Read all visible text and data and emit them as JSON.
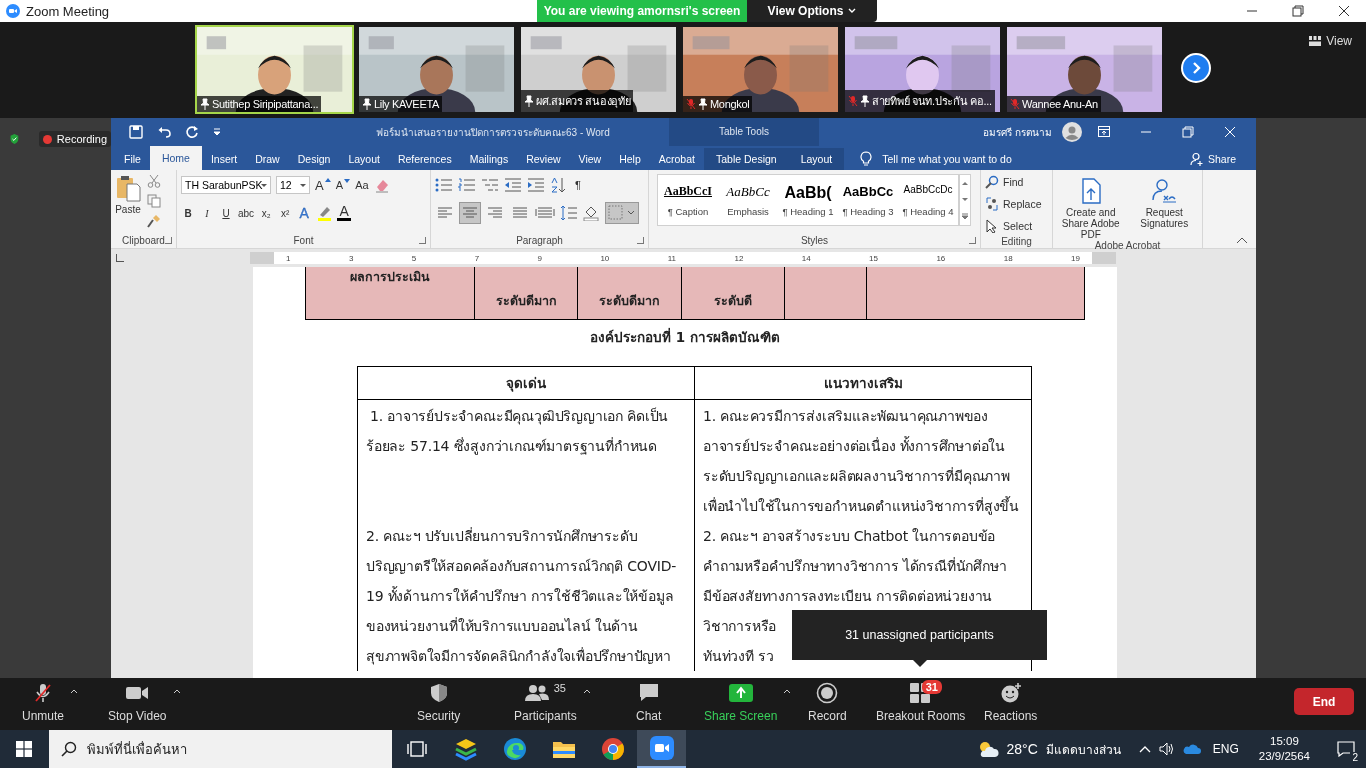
{
  "zoom": {
    "title": "Zoom Meeting",
    "banner": "You are viewing amornsri's screen",
    "view_options": "View Options"
  },
  "video_strip": {
    "view_button": "View",
    "tiles": [
      {
        "name": "Sutithep Siripipattana...",
        "pinned": true,
        "muted": false,
        "speaking": true
      },
      {
        "name": "Lily KAVEETA",
        "pinned": true,
        "muted": false,
        "speaking": false
      },
      {
        "name": "ผศ.สมควร  สนองอุทัย",
        "pinned": true,
        "muted": false,
        "speaking": false
      },
      {
        "name": "Mongkol",
        "pinned": true,
        "muted": true,
        "speaking": false
      },
      {
        "name": "สายทิพย์ จนท.ประกัน คอ...",
        "pinned": true,
        "muted": true,
        "speaking": false
      },
      {
        "name": "Wannee Anu-An",
        "pinned": false,
        "muted": true,
        "speaking": false
      }
    ]
  },
  "recording": {
    "label": "Recording"
  },
  "word": {
    "title": "ฟอร์มนำเสนอรายงานปิดการตรวจระดับคณะ63  -  Word",
    "table_tools": "Table Tools",
    "user": "อมรศรี กรตนาม",
    "tabs": [
      {
        "label": "File",
        "selected": false,
        "contextual": false
      },
      {
        "label": "Home",
        "selected": true,
        "contextual": false
      },
      {
        "label": "Insert",
        "selected": false,
        "contextual": false
      },
      {
        "label": "Draw",
        "selected": false,
        "contextual": false
      },
      {
        "label": "Design",
        "selected": false,
        "contextual": false
      },
      {
        "label": "Layout",
        "selected": false,
        "contextual": false
      },
      {
        "label": "References",
        "selected": false,
        "contextual": false
      },
      {
        "label": "Mailings",
        "selected": false,
        "contextual": false
      },
      {
        "label": "Review",
        "selected": false,
        "contextual": false
      },
      {
        "label": "View",
        "selected": false,
        "contextual": false
      },
      {
        "label": "Help",
        "selected": false,
        "contextual": false
      },
      {
        "label": "Acrobat",
        "selected": false,
        "contextual": false
      },
      {
        "label": "Table Design",
        "selected": false,
        "contextual": true
      },
      {
        "label": "Layout",
        "selected": false,
        "contextual": true
      }
    ],
    "tell_me": "Tell me what you want to do",
    "share": "Share",
    "ribbon": {
      "clipboard": {
        "paste": "Paste",
        "label": "Clipboard"
      },
      "font": {
        "name": "TH SarabunPSK",
        "size": "12",
        "grow": "A",
        "shrink": "A",
        "change_case": "Aa",
        "format_buttons": [
          "B",
          "I",
          "U",
          "abc",
          "x₂",
          "x²"
        ],
        "effects": "A",
        "color_letter": "A",
        "label": "Font"
      },
      "paragraph": {
        "pilcrow": "¶",
        "label": "Paragraph"
      },
      "styles": {
        "label": "Styles",
        "items": [
          {
            "sample": "AaBbCcI",
            "label": "¶ Caption",
            "kind": "caption"
          },
          {
            "sample": "AaBbCc",
            "label": "Emphasis",
            "kind": "emphasis"
          },
          {
            "sample": "AaBb(",
            "label": "¶ Heading 1",
            "kind": "h1"
          },
          {
            "sample": "AaBbCc",
            "label": "¶ Heading 3",
            "kind": "h3"
          },
          {
            "sample": "AaBbCcDc",
            "label": "¶ Heading 4",
            "kind": "h4"
          }
        ]
      },
      "editing": {
        "label": "Editing",
        "items": [
          {
            "label": "Find",
            "kind": "find"
          },
          {
            "label": "Replace",
            "kind": "replace"
          },
          {
            "label": "Select",
            "kind": "select"
          }
        ]
      },
      "acrobat": {
        "label": "Adobe Acrobat",
        "items": [
          {
            "label": "Create and Share Adobe PDF",
            "kind": "pdf"
          },
          {
            "label": "Request Signatures",
            "kind": "sign"
          }
        ]
      }
    },
    "ruler": {
      "numbers": [
        "1",
        "3",
        "5",
        "7",
        "9",
        "10",
        "11",
        "12",
        "14",
        "15",
        "16",
        "18",
        "19"
      ]
    }
  },
  "document": {
    "score_row": [
      "ผลการประเมิน",
      "ระดับดีมาก",
      "ระดับดีมาก",
      "ระดับดี"
    ],
    "heading": "องค์ประกอบที่ 1 การผลิตบัณฑิต",
    "table": {
      "columns": [
        "จุดเด่น",
        "แนวทางเสริม"
      ],
      "rows": [
        [
          [
            "1. อาจารย์ประจำคณะมีคุณวุฒิปริญญาเอก คิดเป็น",
            "ร้อยละ 57.14 ซึ่งสูงกว่าเกณฑ์มาตรฐานที่กำหนด"
          ],
          [
            "1. คณะควรมีการส่งเสริมและพัฒนาคุณภาพของ",
            "อาจารย์ประจำคณะอย่างต่อเนื่อง ทั้งการศึกษาต่อใน",
            "ระดับปริญญาเอกและผลิตผลงานวิชาการที่มีคุณภาพ",
            "เพื่อนำไปใช้ในการขอกำหนดตำแหน่งวิชาการที่สูงขึ้น"
          ]
        ],
        [
          [
            "2. คณะฯ ปรับเปลี่ยนการบริการนักศึกษาระดับ",
            "ปริญญาตรีให้สอดคล้องกับสถานการณ์วิกฤติ COVID-",
            "19 ทั้งด้านการให้คำปรึกษา การใช้ชีวิตและให้ข้อมูล",
            "ของหน่วยงานที่ให้บริการแบบออนไลน์ ในด้าน",
            "สุขภาพจิตใจมีการจัดคลินิกกำลังใจเพื่อปรึกษาปัญหา"
          ],
          [
            "2. คณะฯ อาจสร้างระบบ Chatbot ในการตอบข้อ",
            "คำถามหรือคำปรึกษาทางวิชาการ ได้กรณีที่นักศึกษา",
            "มีข้อสงสัยทางการลงทะเบียน การติดต่อหน่วยงาน",
            "วิชาการหรือ",
            "ทันท่วงที  รว"
          ]
        ]
      ]
    }
  },
  "tooltip": "31 unassigned participants",
  "toolbar": {
    "items": [
      {
        "label": "Unmute",
        "kind": "mic",
        "menu": true
      },
      {
        "label": "Stop Video",
        "kind": "video",
        "menu": true
      },
      {
        "label": "Security",
        "kind": "security"
      },
      {
        "label": "Participants",
        "kind": "participants",
        "count": "35",
        "menu": true
      },
      {
        "label": "Chat",
        "kind": "chat"
      },
      {
        "label": "Share Screen",
        "kind": "share",
        "menu": true
      },
      {
        "label": "Record",
        "kind": "record"
      },
      {
        "label": "Breakout Rooms",
        "kind": "breakout",
        "badge": "31"
      },
      {
        "label": "Reactions",
        "kind": "reactions"
      }
    ],
    "end": "End"
  },
  "taskbar": {
    "search_placeholder": "พิมพ์ที่นี่เพื่อค้นหา",
    "apps": [
      {
        "kind": "taskview",
        "active": false
      },
      {
        "kind": "stack",
        "active": false
      },
      {
        "kind": "edge",
        "active": false
      },
      {
        "kind": "folder",
        "active": false
      },
      {
        "kind": "chrome",
        "active": false
      },
      {
        "kind": "zoom",
        "active": true
      }
    ],
    "temperature": "28°C",
    "weather": "มีแดดบางส่วน",
    "language": "ENG",
    "time": "15:09",
    "date": "23/9/2564",
    "notifications": "2"
  }
}
